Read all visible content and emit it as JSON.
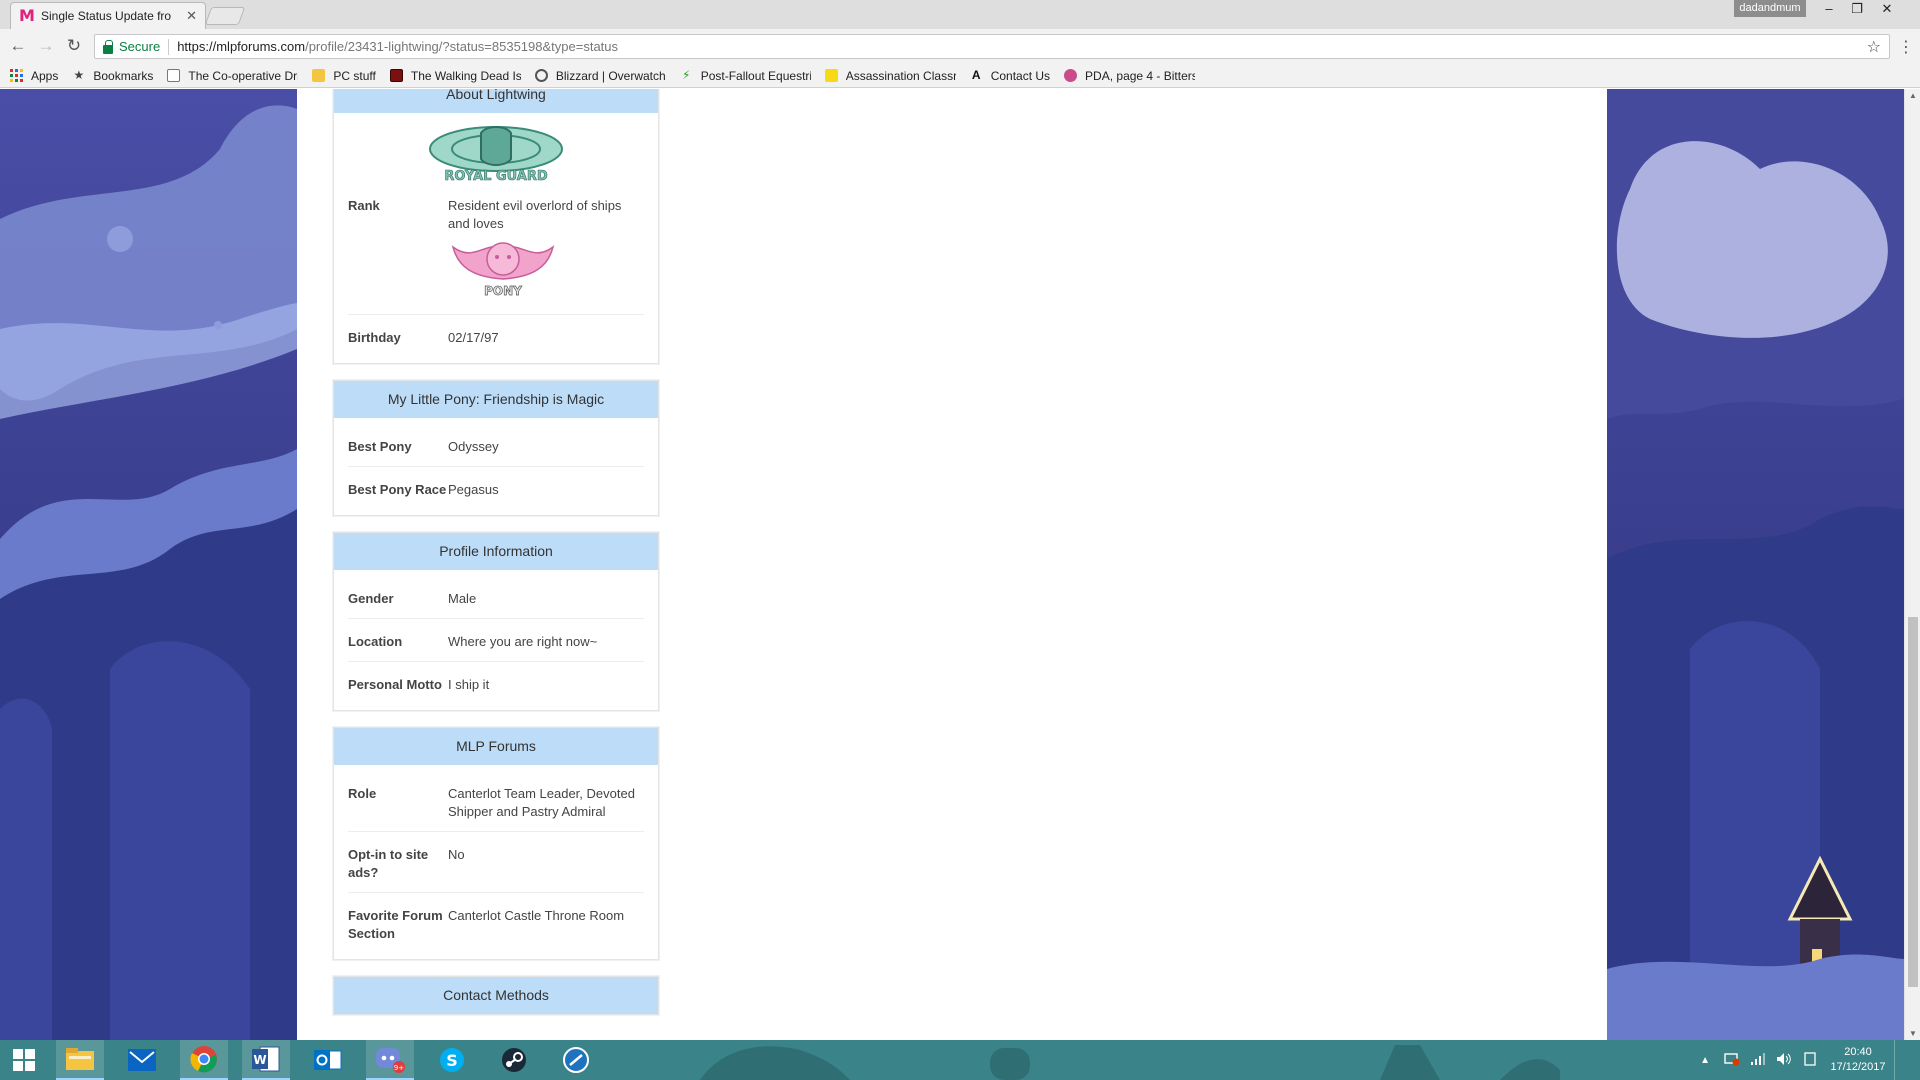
{
  "browser": {
    "tab_title": "Single Status Update fro",
    "tab_favicon": "M",
    "user": "dadandmum",
    "secure_label": "Secure",
    "url_host": "https://mlpforums.com",
    "url_path": "/profile/23431-lightwing/?status=8535198&type=status"
  },
  "bookmarks": [
    {
      "label": "Apps",
      "icon": "apps-grid-icon"
    },
    {
      "label": "Bookmarks",
      "icon": "star-icon"
    },
    {
      "label": "The Co-operative Dri",
      "icon": "page-icon"
    },
    {
      "label": "PC stuff",
      "icon": "folder-icon"
    },
    {
      "label": "The Walking Dead Iss",
      "icon": "twd-icon"
    },
    {
      "label": "Blizzard | Overwatch",
      "icon": "overwatch-icon"
    },
    {
      "label": "Post-Fallout Equestri",
      "icon": "leaf-icon"
    },
    {
      "label": "Assassination Classro",
      "icon": "note-icon"
    },
    {
      "label": "Contact Us",
      "icon": "a-logo-icon"
    },
    {
      "label": "PDA, page 4 - Bitters",
      "icon": "pda-icon"
    }
  ],
  "about": {
    "header": "About Lightwing",
    "emblem_text": "ROYAL GUARD",
    "rank_label": "Rank",
    "rank_value": "Resident evil overlord of ships and loves",
    "pony_text": "PONY",
    "birthday_label": "Birthday",
    "birthday_value": "02/17/97"
  },
  "mlp": {
    "header": "My Little Pony: Friendship is Magic",
    "best_pony_label": "Best Pony",
    "best_pony_value": "Odyssey",
    "best_race_label": "Best Pony Race",
    "best_race_value": "Pegasus"
  },
  "profile_info": {
    "header": "Profile Information",
    "gender_label": "Gender",
    "gender_value": "Male",
    "location_label": "Location",
    "location_value": "Where you are right now~",
    "motto_label": "Personal Motto",
    "motto_value": "I ship it"
  },
  "forums": {
    "header": "MLP Forums",
    "role_label": "Role",
    "role_value": "Canterlot Team Leader, Devoted Shipper and Pastry Admiral",
    "ads_label": "Opt-in to site ads?",
    "ads_value": "No",
    "section_label": "Favorite Forum Section",
    "section_value": "Canterlot Castle Throne Room"
  },
  "contact": {
    "header": "Contact Methods"
  },
  "taskbar": {
    "time": "20:40",
    "date": "17/12/2017",
    "discord_badge": "9+"
  },
  "colors": {
    "block_header": "#bcdcf8",
    "taskbar": "#3a8388",
    "sky_dark": "#3b3f8f",
    "sky_light": "#6f7cc7"
  }
}
